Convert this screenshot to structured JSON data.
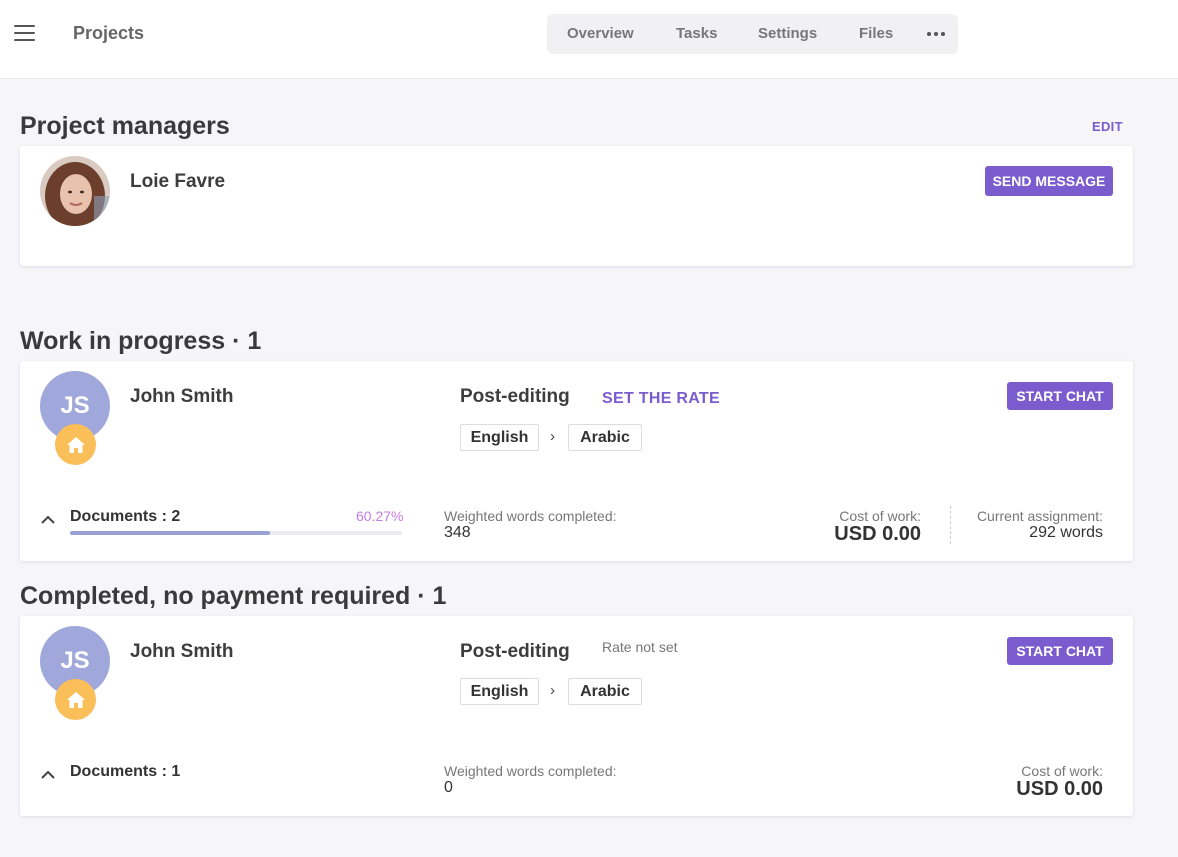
{
  "app": {
    "title": "Projects"
  },
  "nav": {
    "tabs": [
      "Overview",
      "Tasks",
      "Settings",
      "Files"
    ]
  },
  "managers": {
    "title": "Project managers",
    "edit_label": "EDIT",
    "person": {
      "name": "Loie Favre",
      "button": "SEND MESSAGE"
    }
  },
  "wip": {
    "title": "Work in progress · 1",
    "assignee": {
      "initials": "JS",
      "name": "John Smith"
    },
    "service": "Post-editing",
    "rate_action": "SET THE RATE",
    "chat_button": "START CHAT",
    "source_lang": "English",
    "target_lang": "Arabic",
    "documents_label": "Documents : 2",
    "progress_percent": "60.27%",
    "progress_value": 60.27,
    "weighted_label": "Weighted words completed:",
    "weighted_value": "348",
    "cost_label": "Cost of work:",
    "cost_value": "USD 0.00",
    "assignment_label": "Current assignment:",
    "assignment_value": "292 words"
  },
  "completed": {
    "title": "Completed, no payment required · 1",
    "assignee": {
      "initials": "JS",
      "name": "John Smith"
    },
    "service": "Post-editing",
    "rate_status": "Rate not set",
    "chat_button": "START CHAT",
    "source_lang": "English",
    "target_lang": "Arabic",
    "documents_label": "Documents : 1",
    "weighted_label": "Weighted words completed:",
    "weighted_value": "0",
    "cost_label": "Cost of work:",
    "cost_value": "USD 0.00"
  },
  "colors": {
    "accent": "#7b5ccf",
    "avatar": "#a0a7da",
    "home_badge": "#fbbf59",
    "progress": "#99a2d3",
    "percent": "#c77be0"
  },
  "icons": {
    "menu": "hamburger-icon",
    "more": "more-horizontal-icon",
    "home": "home-icon",
    "collapse": "chevron-up-icon",
    "lang_arrow": "chevron-right-icon"
  }
}
